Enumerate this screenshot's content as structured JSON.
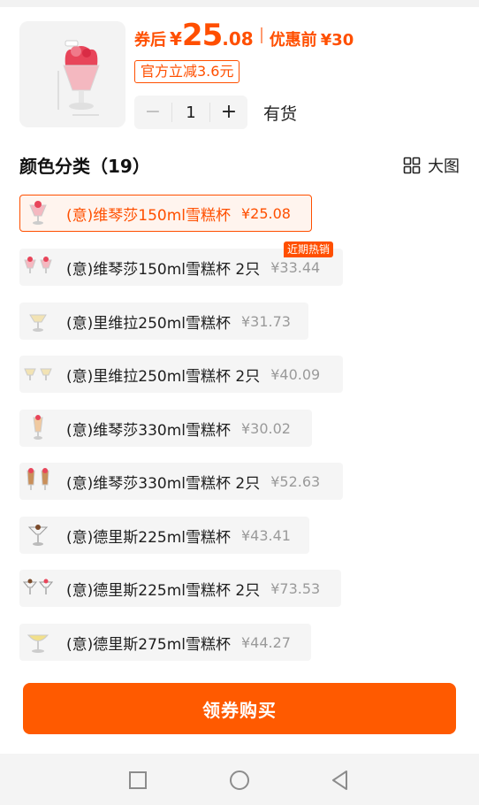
{
  "product": {
    "price_prefix": "券后",
    "currency": "¥",
    "price_int": "25",
    "price_dec": ".08",
    "orig_label": "优惠前",
    "orig_currency": "¥",
    "orig_price": "30",
    "discount_tag": "官方立减3.6元",
    "quantity": "1",
    "stock": "有货",
    "minus_label": "−",
    "plus_label": "+"
  },
  "section": {
    "title": "颜色分类（19）",
    "big_view_label": "大图"
  },
  "hot_tag": "近期热销",
  "variants": [
    {
      "name": "(意)维琴莎150ml雪糕杯",
      "price": "¥25.08",
      "selected": true
    },
    {
      "name": "(意)维琴莎150ml雪糕杯 2只",
      "price": "¥33.44",
      "selected": false
    },
    {
      "name": "(意)里维拉250ml雪糕杯",
      "price": "¥31.73",
      "selected": false
    },
    {
      "name": "(意)里维拉250ml雪糕杯 2只",
      "price": "¥40.09",
      "selected": false
    },
    {
      "name": "(意)维琴莎330ml雪糕杯",
      "price": "¥30.02",
      "selected": false
    },
    {
      "name": "(意)维琴莎330ml雪糕杯 2只",
      "price": "¥52.63",
      "selected": false
    },
    {
      "name": "(意)德里斯225ml雪糕杯",
      "price": "¥43.41",
      "selected": false
    },
    {
      "name": "(意)德里斯225ml雪糕杯 2只",
      "price": "¥73.53",
      "selected": false
    },
    {
      "name": "(意)德里斯275ml雪糕杯",
      "price": "¥44.27",
      "selected": false
    }
  ],
  "buy_button": "领券购买",
  "colors": {
    "accent": "#ff4f00",
    "button": "#ff5a00"
  },
  "icons": {
    "big_view": "grid-icon",
    "nav_recent": "square-icon",
    "nav_home": "circle-icon",
    "nav_back": "triangle-back-icon"
  }
}
